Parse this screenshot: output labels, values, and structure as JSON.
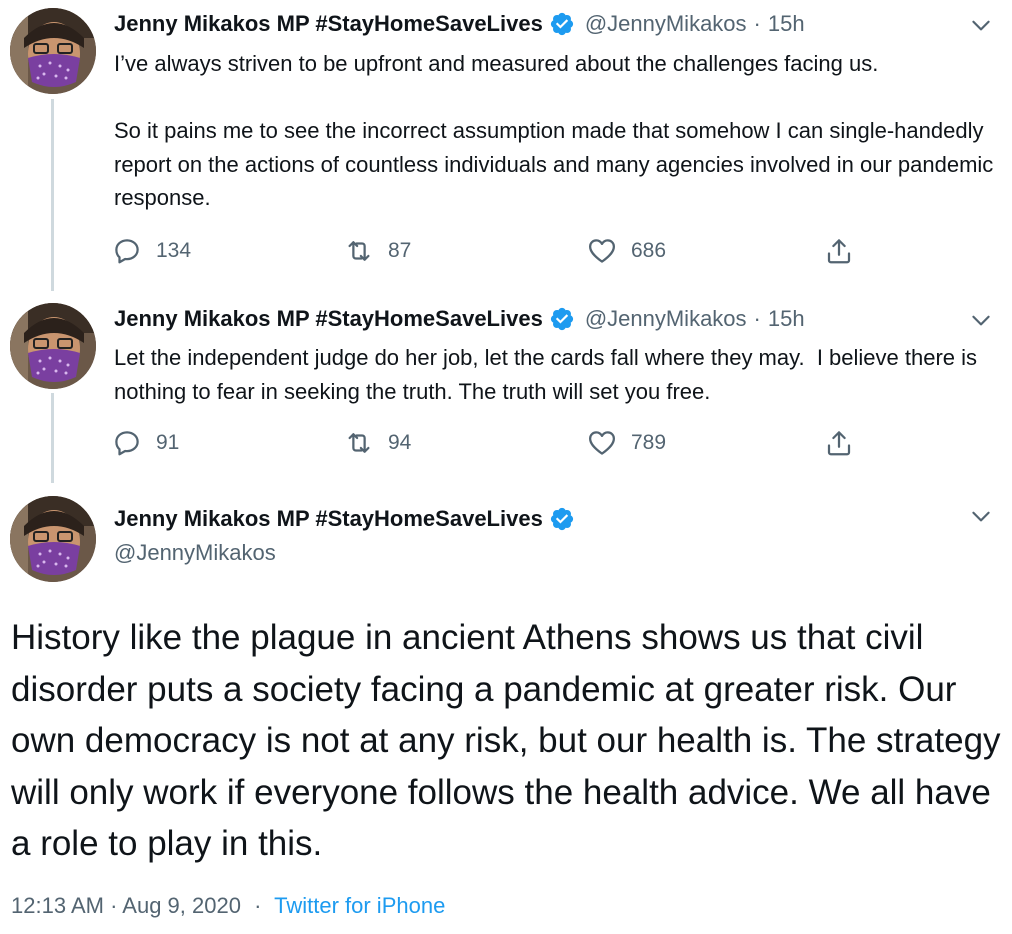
{
  "tweets": [
    {
      "display_name": "Jenny Mikakos MP #StayHomeSaveLives",
      "handle": "@JennyMikakos",
      "separator": "·",
      "time": "15h",
      "text": "I’ve always striven to be upfront and measured about the challenges facing us.\n\nSo it pains me to see the incorrect assumption made that somehow I can single-handedly report on the actions of countless individuals and many agencies involved in our pandemic response.",
      "replies": "134",
      "retweets": "87",
      "likes": "686"
    },
    {
      "display_name": "Jenny Mikakos MP #StayHomeSaveLives",
      "handle": "@JennyMikakos",
      "separator": "·",
      "time": "15h",
      "text": "Let the independent judge do her job, let the cards fall where they may.  I believe there is nothing to fear in seeking the truth. The truth will set you free.",
      "replies": "91",
      "retweets": "94",
      "likes": "789"
    }
  ],
  "main_tweet": {
    "display_name": "Jenny Mikakos MP #StayHomeSaveLives",
    "handle": "@JennyMikakos",
    "text": "History like the plague in ancient Athens shows us that civil disorder puts a society facing a pandemic at greater risk. Our own democracy is not at any risk, but our health is. The strategy will only work if everyone follows the health advice. We all have a role to play in this.",
    "timestamp": "12:13 AM · Aug 9, 2020",
    "meta_separator": "·",
    "source": "Twitter for iPhone"
  },
  "colors": {
    "accent": "#1d9bf0",
    "text_primary": "#0f1419",
    "text_secondary": "#536471",
    "thread_line": "#cfd9de"
  },
  "icons": {
    "verified": "verified-badge-icon",
    "caret": "chevron-down-icon",
    "reply": "reply-icon",
    "retweet": "retweet-icon",
    "like": "heart-icon",
    "share": "share-icon"
  }
}
